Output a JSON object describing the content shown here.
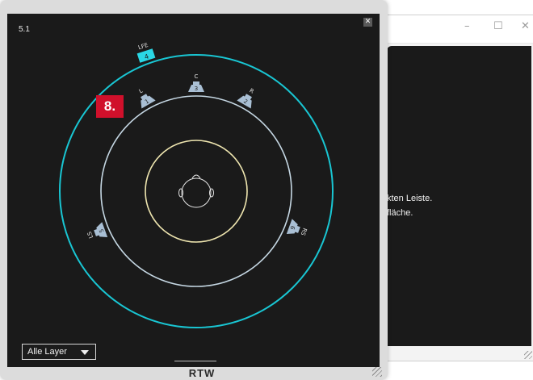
{
  "background_window": {
    "controls": {
      "minimize": "–",
      "maximize": "☐",
      "close": "✕"
    },
    "text_lines": [
      "kten Leiste.",
      "fläche."
    ]
  },
  "main_window": {
    "layout_label": "5.1",
    "close_glyph": "✕",
    "marker_label": "8.",
    "layer_dropdown": {
      "selected": "Alle Layer"
    },
    "brand_text": "RTW"
  },
  "speakers": [
    {
      "id": "lfe",
      "name": "LFE",
      "number": "4"
    },
    {
      "id": "l",
      "name": "L",
      "number": "1"
    },
    {
      "id": "c",
      "name": "C",
      "number": "3"
    },
    {
      "id": "r",
      "name": "R",
      "number": "2"
    },
    {
      "id": "ls",
      "name": "LS",
      "number": "5"
    },
    {
      "id": "rs",
      "name": "RS",
      "number": "6"
    }
  ],
  "colors": {
    "outer_ring": "#19c6d3",
    "middle_ring": "#c5d7e3",
    "inner_ring": "#efe6b0",
    "speaker_fill": "#a9bfd4",
    "lfe_fill": "#2ad7e5",
    "marker": "#d0102b"
  }
}
